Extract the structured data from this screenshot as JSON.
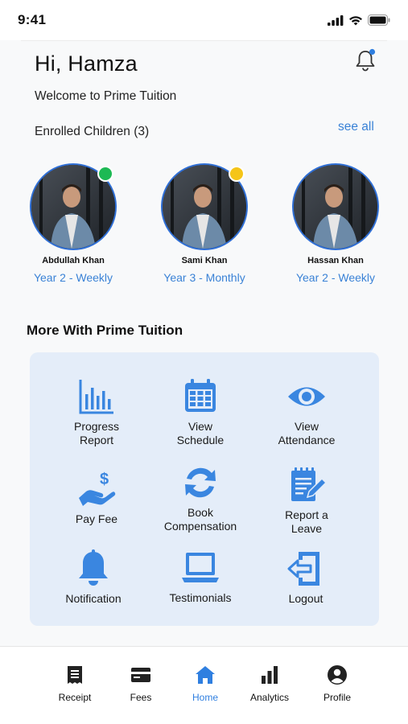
{
  "status_bar": {
    "time": "9:41"
  },
  "header": {
    "greeting": "Hi, Hamza",
    "welcome": "Welcome to Prime Tuition"
  },
  "enrolled": {
    "title": "Enrolled Children (3)",
    "see_all": "see all",
    "children": [
      {
        "name": "Abdullah Khan",
        "plan": "Year 2 - Weekly",
        "status_color": "#1db954"
      },
      {
        "name": "Sami Khan",
        "plan": "Year 3 - Monthly",
        "status_color": "#f5c518"
      },
      {
        "name": "Hassan Khan",
        "plan": "Year 2 - Weekly",
        "status_color": ""
      }
    ]
  },
  "more": {
    "title": "More With Prime Tuition",
    "tiles": [
      {
        "label": "Progress\nReport",
        "icon": "bar-chart-icon"
      },
      {
        "label": "View\nSchedule",
        "icon": "calendar-icon"
      },
      {
        "label": "View\nAttendance",
        "icon": "eye-icon"
      },
      {
        "label": "Pay Fee",
        "icon": "pay-hand-icon"
      },
      {
        "label": "Book\nCompensation",
        "icon": "refresh-icon"
      },
      {
        "label": "Report a\nLeave",
        "icon": "edit-document-icon"
      },
      {
        "label": "Notification",
        "icon": "bell-icon"
      },
      {
        "label": "Testimonials",
        "icon": "laptop-icon"
      },
      {
        "label": "Logout",
        "icon": "logout-icon"
      }
    ]
  },
  "bottom_nav": {
    "items": [
      {
        "label": "Receipt",
        "icon": "receipt-icon"
      },
      {
        "label": "Fees",
        "icon": "card-icon"
      },
      {
        "label": "Home",
        "icon": "home-icon",
        "active": true
      },
      {
        "label": "Analytics",
        "icon": "analytics-icon"
      },
      {
        "label": "Profile",
        "icon": "profile-icon"
      }
    ]
  },
  "colors": {
    "accent": "#2f7fe0",
    "card_bg": "#e4edf9",
    "icon_blue": "#3a86e0"
  }
}
